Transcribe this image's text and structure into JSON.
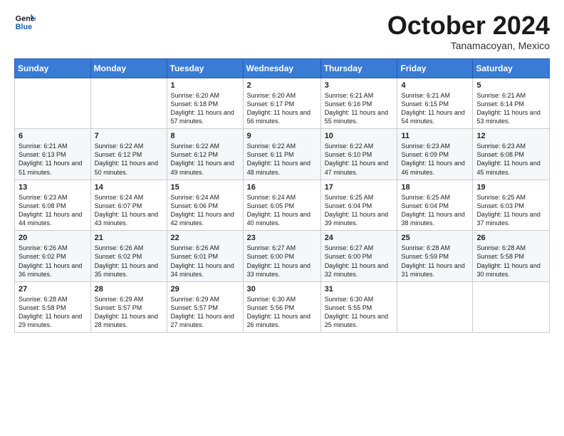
{
  "header": {
    "logo_line1": "General",
    "logo_line2": "Blue",
    "month": "October 2024",
    "location": "Tanamacoyan, Mexico"
  },
  "weekdays": [
    "Sunday",
    "Monday",
    "Tuesday",
    "Wednesday",
    "Thursday",
    "Friday",
    "Saturday"
  ],
  "weeks": [
    [
      {
        "day": "",
        "sunrise": "",
        "sunset": "",
        "daylight": ""
      },
      {
        "day": "",
        "sunrise": "",
        "sunset": "",
        "daylight": ""
      },
      {
        "day": "1",
        "sunrise": "Sunrise: 6:20 AM",
        "sunset": "Sunset: 6:18 PM",
        "daylight": "Daylight: 11 hours and 57 minutes."
      },
      {
        "day": "2",
        "sunrise": "Sunrise: 6:20 AM",
        "sunset": "Sunset: 6:17 PM",
        "daylight": "Daylight: 11 hours and 56 minutes."
      },
      {
        "day": "3",
        "sunrise": "Sunrise: 6:21 AM",
        "sunset": "Sunset: 6:16 PM",
        "daylight": "Daylight: 11 hours and 55 minutes."
      },
      {
        "day": "4",
        "sunrise": "Sunrise: 6:21 AM",
        "sunset": "Sunset: 6:15 PM",
        "daylight": "Daylight: 11 hours and 54 minutes."
      },
      {
        "day": "5",
        "sunrise": "Sunrise: 6:21 AM",
        "sunset": "Sunset: 6:14 PM",
        "daylight": "Daylight: 11 hours and 53 minutes."
      }
    ],
    [
      {
        "day": "6",
        "sunrise": "Sunrise: 6:21 AM",
        "sunset": "Sunset: 6:13 PM",
        "daylight": "Daylight: 11 hours and 51 minutes."
      },
      {
        "day": "7",
        "sunrise": "Sunrise: 6:22 AM",
        "sunset": "Sunset: 6:12 PM",
        "daylight": "Daylight: 11 hours and 50 minutes."
      },
      {
        "day": "8",
        "sunrise": "Sunrise: 6:22 AM",
        "sunset": "Sunset: 6:12 PM",
        "daylight": "Daylight: 11 hours and 49 minutes."
      },
      {
        "day": "9",
        "sunrise": "Sunrise: 6:22 AM",
        "sunset": "Sunset: 6:11 PM",
        "daylight": "Daylight: 11 hours and 48 minutes."
      },
      {
        "day": "10",
        "sunrise": "Sunrise: 6:22 AM",
        "sunset": "Sunset: 6:10 PM",
        "daylight": "Daylight: 11 hours and 47 minutes."
      },
      {
        "day": "11",
        "sunrise": "Sunrise: 6:23 AM",
        "sunset": "Sunset: 6:09 PM",
        "daylight": "Daylight: 11 hours and 46 minutes."
      },
      {
        "day": "12",
        "sunrise": "Sunrise: 6:23 AM",
        "sunset": "Sunset: 6:08 PM",
        "daylight": "Daylight: 11 hours and 45 minutes."
      }
    ],
    [
      {
        "day": "13",
        "sunrise": "Sunrise: 6:23 AM",
        "sunset": "Sunset: 6:08 PM",
        "daylight": "Daylight: 11 hours and 44 minutes."
      },
      {
        "day": "14",
        "sunrise": "Sunrise: 6:24 AM",
        "sunset": "Sunset: 6:07 PM",
        "daylight": "Daylight: 11 hours and 43 minutes."
      },
      {
        "day": "15",
        "sunrise": "Sunrise: 6:24 AM",
        "sunset": "Sunset: 6:06 PM",
        "daylight": "Daylight: 11 hours and 42 minutes."
      },
      {
        "day": "16",
        "sunrise": "Sunrise: 6:24 AM",
        "sunset": "Sunset: 6:05 PM",
        "daylight": "Daylight: 11 hours and 40 minutes."
      },
      {
        "day": "17",
        "sunrise": "Sunrise: 6:25 AM",
        "sunset": "Sunset: 6:04 PM",
        "daylight": "Daylight: 11 hours and 39 minutes."
      },
      {
        "day": "18",
        "sunrise": "Sunrise: 6:25 AM",
        "sunset": "Sunset: 6:04 PM",
        "daylight": "Daylight: 11 hours and 38 minutes."
      },
      {
        "day": "19",
        "sunrise": "Sunrise: 6:25 AM",
        "sunset": "Sunset: 6:03 PM",
        "daylight": "Daylight: 11 hours and 37 minutes."
      }
    ],
    [
      {
        "day": "20",
        "sunrise": "Sunrise: 6:26 AM",
        "sunset": "Sunset: 6:02 PM",
        "daylight": "Daylight: 11 hours and 36 minutes."
      },
      {
        "day": "21",
        "sunrise": "Sunrise: 6:26 AM",
        "sunset": "Sunset: 6:02 PM",
        "daylight": "Daylight: 11 hours and 35 minutes."
      },
      {
        "day": "22",
        "sunrise": "Sunrise: 6:26 AM",
        "sunset": "Sunset: 6:01 PM",
        "daylight": "Daylight: 11 hours and 34 minutes."
      },
      {
        "day": "23",
        "sunrise": "Sunrise: 6:27 AM",
        "sunset": "Sunset: 6:00 PM",
        "daylight": "Daylight: 11 hours and 33 minutes."
      },
      {
        "day": "24",
        "sunrise": "Sunrise: 6:27 AM",
        "sunset": "Sunset: 6:00 PM",
        "daylight": "Daylight: 11 hours and 32 minutes."
      },
      {
        "day": "25",
        "sunrise": "Sunrise: 6:28 AM",
        "sunset": "Sunset: 5:59 PM",
        "daylight": "Daylight: 11 hours and 31 minutes."
      },
      {
        "day": "26",
        "sunrise": "Sunrise: 6:28 AM",
        "sunset": "Sunset: 5:58 PM",
        "daylight": "Daylight: 11 hours and 30 minutes."
      }
    ],
    [
      {
        "day": "27",
        "sunrise": "Sunrise: 6:28 AM",
        "sunset": "Sunset: 5:58 PM",
        "daylight": "Daylight: 11 hours and 29 minutes."
      },
      {
        "day": "28",
        "sunrise": "Sunrise: 6:29 AM",
        "sunset": "Sunset: 5:57 PM",
        "daylight": "Daylight: 11 hours and 28 minutes."
      },
      {
        "day": "29",
        "sunrise": "Sunrise: 6:29 AM",
        "sunset": "Sunset: 5:57 PM",
        "daylight": "Daylight: 11 hours and 27 minutes."
      },
      {
        "day": "30",
        "sunrise": "Sunrise: 6:30 AM",
        "sunset": "Sunset: 5:56 PM",
        "daylight": "Daylight: 11 hours and 26 minutes."
      },
      {
        "day": "31",
        "sunrise": "Sunrise: 6:30 AM",
        "sunset": "Sunset: 5:55 PM",
        "daylight": "Daylight: 11 hours and 25 minutes."
      },
      {
        "day": "",
        "sunrise": "",
        "sunset": "",
        "daylight": ""
      },
      {
        "day": "",
        "sunrise": "",
        "sunset": "",
        "daylight": ""
      }
    ]
  ]
}
